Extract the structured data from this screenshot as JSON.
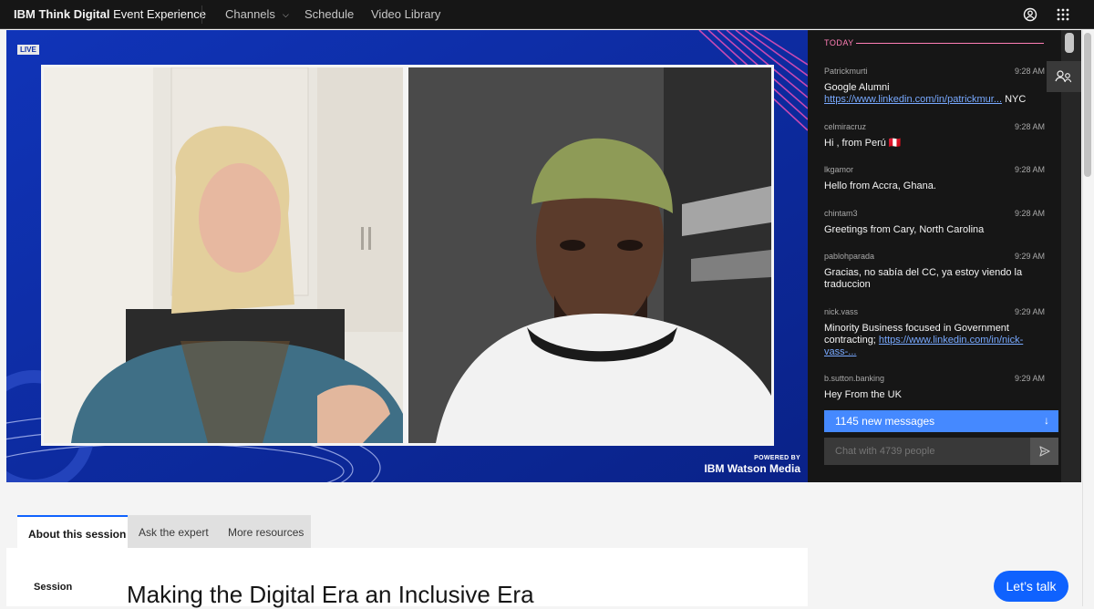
{
  "header": {
    "brand_bold": "IBM Think Digital",
    "brand_rest": " Event Experience",
    "nav": [
      "Channels",
      "Schedule",
      "Video Library"
    ]
  },
  "video": {
    "live_label": "LIVE",
    "powered_by": "POWERED BY",
    "powered_brand": "IBM Watson Media"
  },
  "chat": {
    "today_label": "TODAY",
    "messages": [
      {
        "user": "Patrickmurti",
        "time": "9:28 AM",
        "text": "Google Alumni",
        "link": "https://www.linkedin.com/in/patrickmur...",
        "suffix": " NYC"
      },
      {
        "user": "celmiracruz",
        "time": "9:28 AM",
        "text": "Hi , from Perú 🇵🇪"
      },
      {
        "user": "lkgamor",
        "time": "9:28 AM",
        "text": "Hello from Accra, Ghana."
      },
      {
        "user": "chintam3",
        "time": "9:28 AM",
        "text": "Greetings from Cary, North Carolina"
      },
      {
        "user": "pablohparada",
        "time": "9:29 AM",
        "text": "Gracias, no sabía del CC, ya estoy viendo la traduccion"
      },
      {
        "user": "nick.vass",
        "time": "9:29 AM",
        "text": "Minority Business focused in Government contracting; ",
        "link": "https://www.linkedin.com/in/nick-vass-..."
      },
      {
        "user": "b.sutton.banking",
        "time": "9:29 AM",
        "text": "Hey From the UK"
      }
    ],
    "new_messages": "1145 new messages",
    "input_placeholder": "Chat with 4739 people"
  },
  "tabs": [
    "About this session",
    "Ask the expert",
    "More resources"
  ],
  "session": {
    "label": "Session",
    "title": "Making the Digital Era an Inclusive Era"
  },
  "cta": "Let’s talk",
  "colors": {
    "accent": "#0f62fe",
    "video_bg": "#0f2fa6",
    "chat_bg": "#161616",
    "today_pink": "#ff7eb6",
    "new_msg_blue": "#4589ff"
  },
  "icons": [
    "user-avatar-icon",
    "app-switcher-icon",
    "chevron-down-icon",
    "people-icon",
    "arrow-down-icon",
    "send-icon"
  ]
}
